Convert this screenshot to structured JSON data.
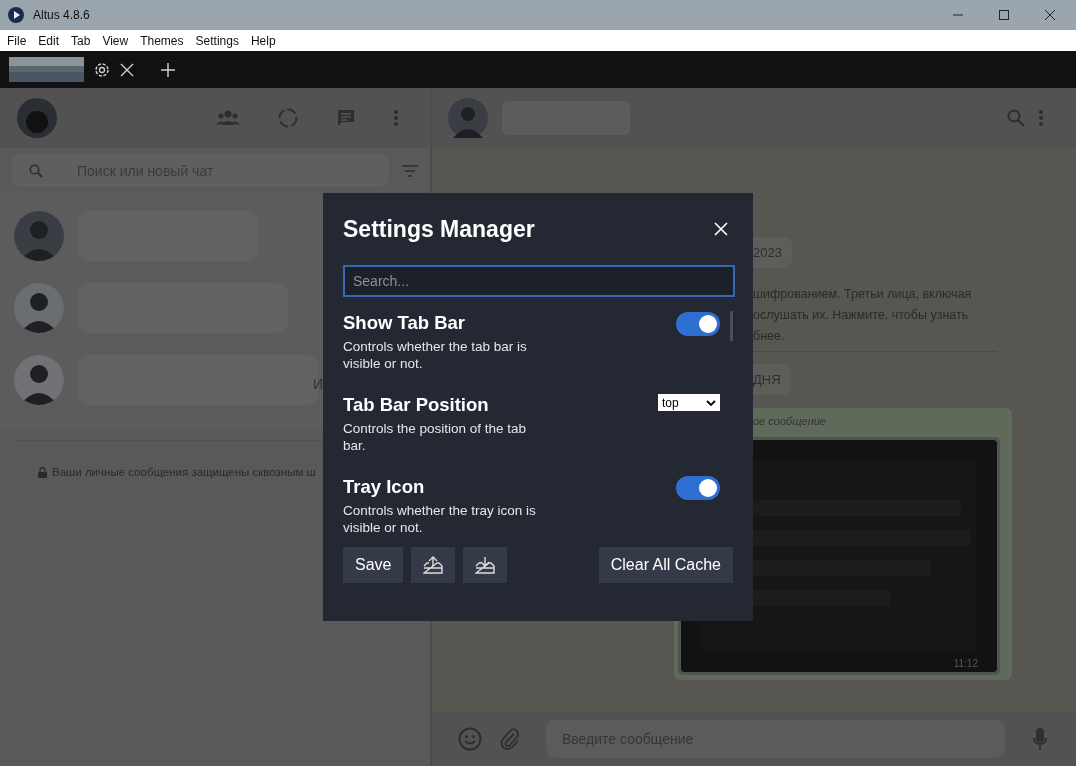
{
  "window": {
    "title": "Altus 4.8.6"
  },
  "menu": [
    "File",
    "Edit",
    "Tab",
    "View",
    "Themes",
    "Settings",
    "Help"
  ],
  "chat_list": {
    "search_placeholder": "Поиск или новый чат",
    "cut_letter": "И",
    "encryption_note": "Ваши личные сообщения защищены сквозным ш"
  },
  "conversation": {
    "date_chip": "2023",
    "notice_lines": [
      "шифрованием. Третьи лица, включая",
      "ослушать их. Нажмите, чтобы узнать",
      "бнее."
    ],
    "day_chip": "ДНЯ",
    "message": {
      "forwarded_label": "ое сообщение",
      "time": "11:12"
    },
    "composer_placeholder": "Введите сообщение"
  },
  "settings_manager": {
    "title": "Settings Manager",
    "search_placeholder": "Search...",
    "settings": [
      {
        "kind": "toggle",
        "label": "Show Tab Bar",
        "description": "Controls whether the tab bar is visible or not.",
        "on": true
      },
      {
        "kind": "select",
        "label": "Tab Bar Position",
        "description": "Controls the position of the tab bar.",
        "value": "top"
      },
      {
        "kind": "toggle",
        "label": "Tray Icon",
        "description": "Controls whether the tray icon is visible or not.",
        "on": true
      }
    ],
    "save_button": "Save",
    "clear_button": "Clear All Cache"
  }
}
